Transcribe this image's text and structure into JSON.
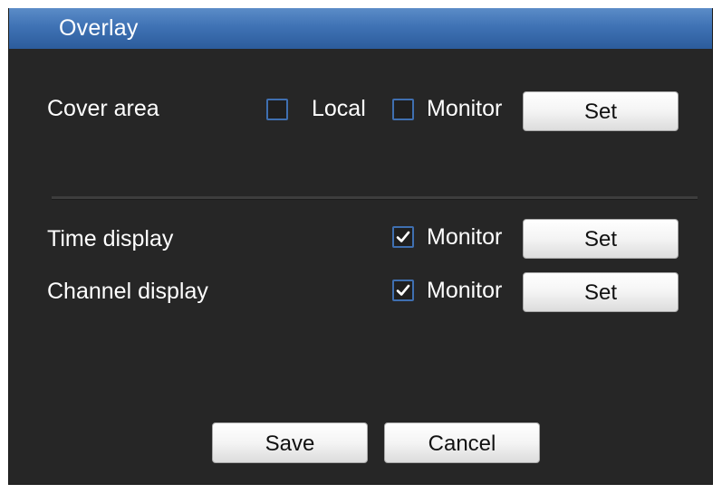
{
  "dialog": {
    "title": "Overlay"
  },
  "cover_area": {
    "label": "Cover area",
    "local_label": "Local",
    "local_checked": false,
    "monitor_label": "Monitor",
    "monitor_checked": false,
    "set_label": "Set"
  },
  "time_display": {
    "label": "Time display",
    "monitor_label": "Monitor",
    "monitor_checked": true,
    "set_label": "Set"
  },
  "channel_display": {
    "label": "Channel display",
    "monitor_label": "Monitor",
    "monitor_checked": true,
    "set_label": "Set"
  },
  "footer": {
    "save_label": "Save",
    "cancel_label": "Cancel"
  },
  "colors": {
    "title_bar": "#3f72b4",
    "background": "#262626",
    "checkbox_border": "#3f6fb0"
  },
  "icons": {
    "check": "check-icon"
  }
}
